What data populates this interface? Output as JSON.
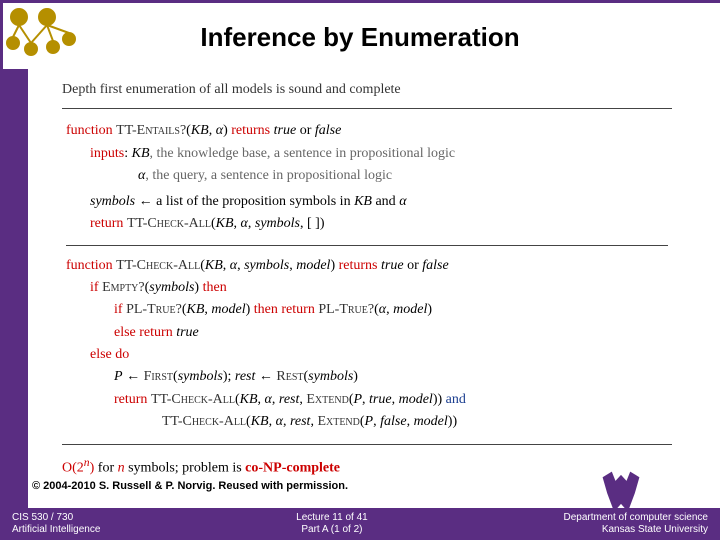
{
  "title": "Inference by Enumeration",
  "intro": "Depth first enumeration of all models is sound and complete",
  "kw": {
    "function": "function",
    "returns": "returns",
    "inputs": "inputs",
    "return": "return",
    "if": "if",
    "then": "then",
    "else": "else",
    "do": "do",
    "and": "and",
    "or": "or",
    "true": "true",
    "false": "false"
  },
  "fn": {
    "entails": "TT-Entails?",
    "checkall": "TT-Check-All",
    "empty": "Empty?",
    "pltrue": "PL-True?",
    "first": "First",
    "rest": "Rest",
    "extend": "Extend"
  },
  "sym": {
    "kb": "KB",
    "alpha": "α",
    "symbols": "symbols",
    "model": "model",
    "P": "P",
    "rest": "rest",
    "n": "n"
  },
  "desc": {
    "kb": ", the knowledge base, a sentence in propositional logic",
    "alpha": ", the query, a sentence in propositional logic",
    "symbols_assign": " ← a list of the proposition symbols in "
  },
  "complexity": {
    "bigO": "O(2",
    "exp": "n",
    "close": ")",
    "for": " for ",
    "symbols_txt": " symbols; problem is ",
    "class": "co-NP-complete"
  },
  "credit": "© 2004-2010 S. Russell & P. Norvig. Reused with permission.",
  "footer": {
    "left1": "CIS 530 / 730",
    "left2": "Artificial Intelligence",
    "center1": "Lecture 11 of 41",
    "center2": "Part A (1 of 2)",
    "right1": "Department of computer science",
    "right2": "Kansas State University"
  }
}
